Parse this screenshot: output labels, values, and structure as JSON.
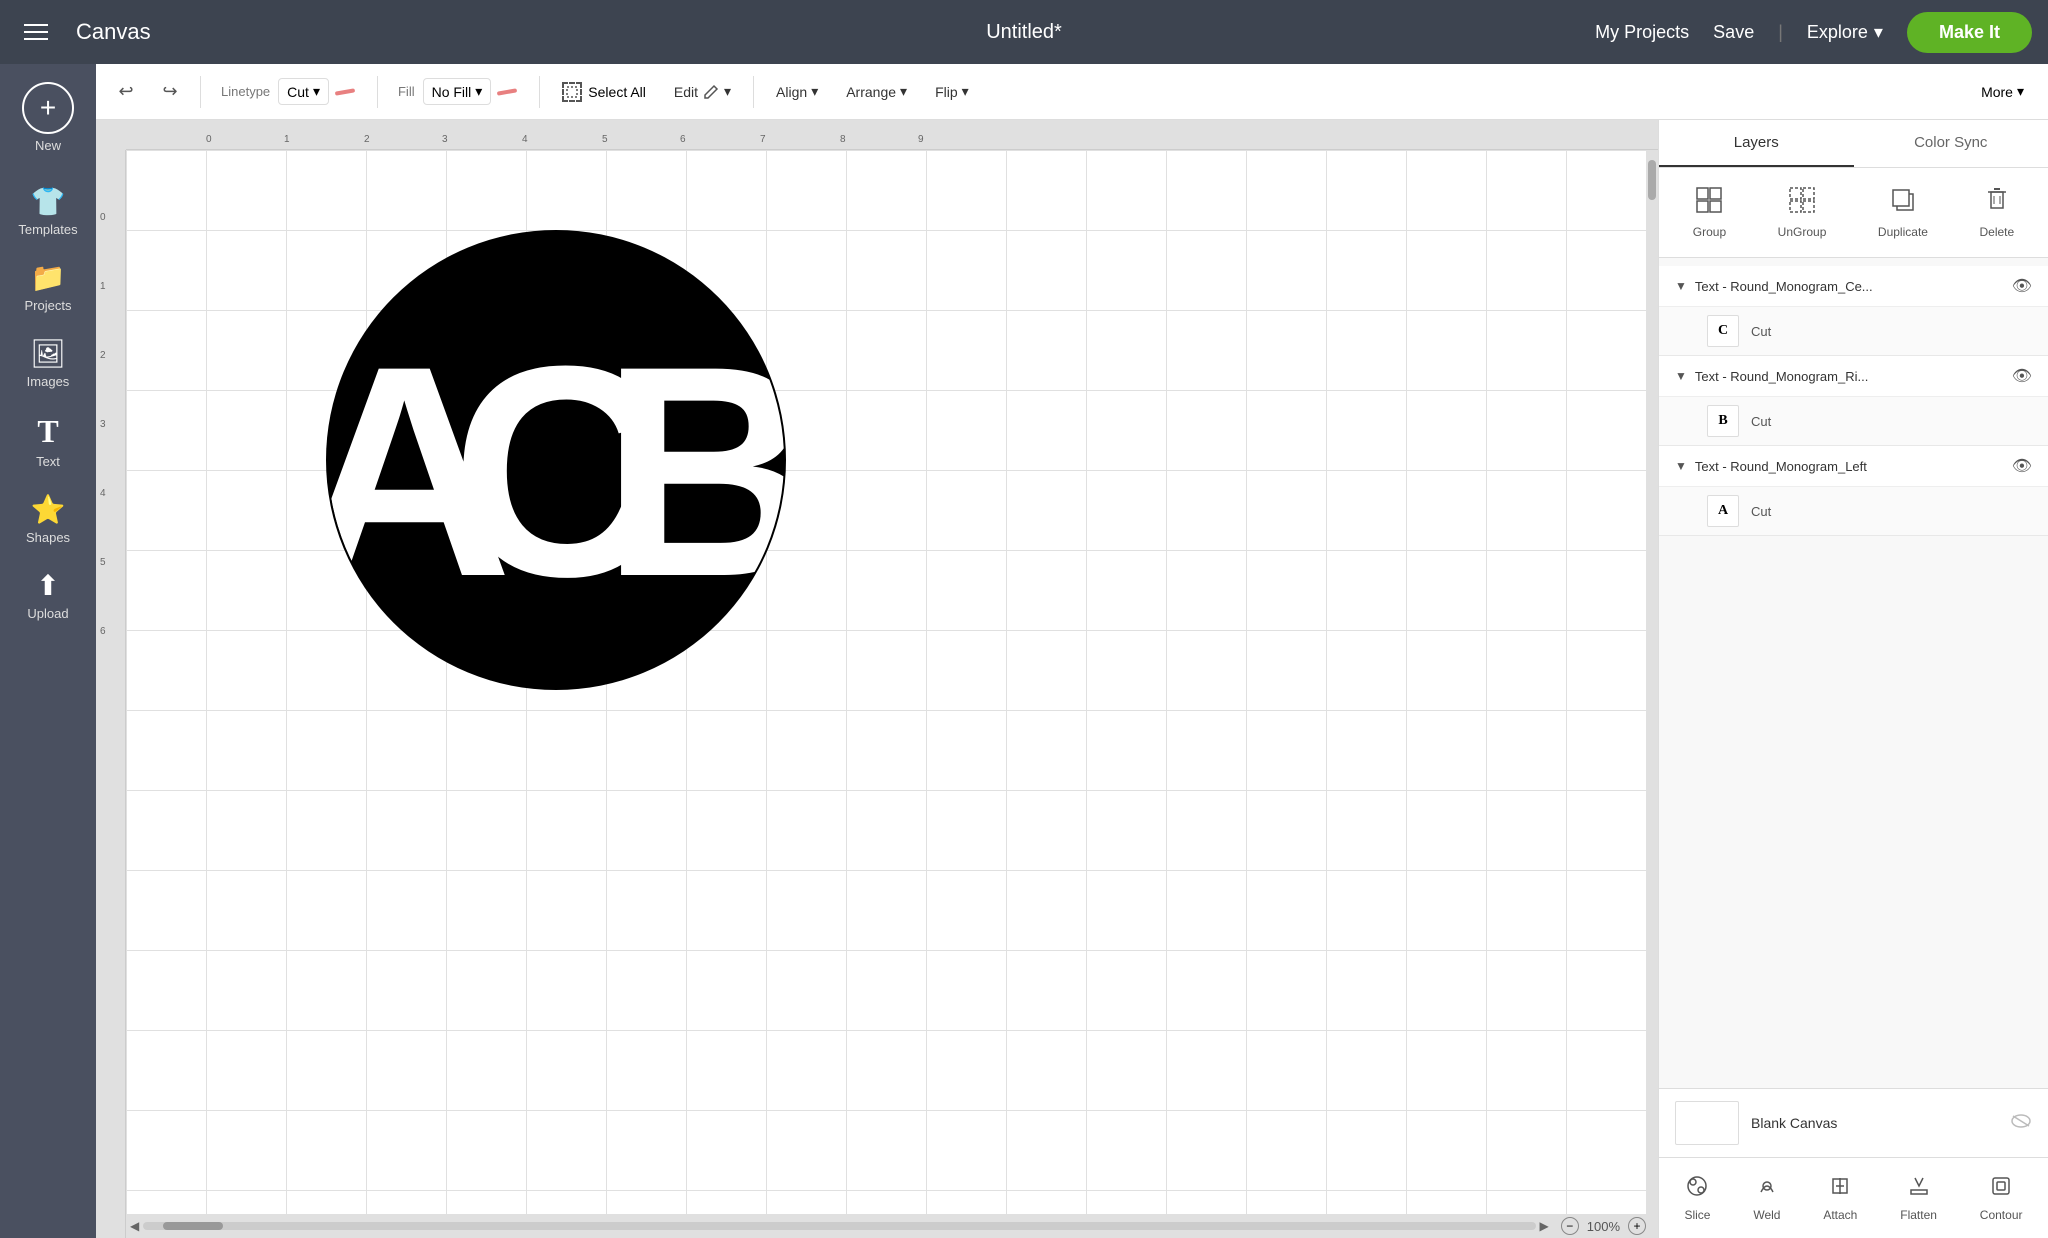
{
  "app": {
    "title": "Canvas",
    "document_title": "Untitled*"
  },
  "topnav": {
    "my_projects": "My Projects",
    "save": "Save",
    "explore": "Explore",
    "make_it": "Make It"
  },
  "sidebar": {
    "new_label": "New",
    "items": [
      {
        "id": "templates",
        "label": "Templates",
        "icon": "👕"
      },
      {
        "id": "projects",
        "label": "Projects",
        "icon": "📁"
      },
      {
        "id": "images",
        "label": "Images",
        "icon": "🖼"
      },
      {
        "id": "text",
        "label": "Text",
        "icon": "T"
      },
      {
        "id": "shapes",
        "label": "Shapes",
        "icon": "⭐"
      },
      {
        "id": "upload",
        "label": "Upload",
        "icon": "⬆"
      }
    ]
  },
  "toolbar": {
    "linetype_label": "Linetype",
    "linetype_value": "Cut",
    "fill_label": "Fill",
    "fill_value": "No Fill",
    "select_all_label": "Select All",
    "edit_label": "Edit",
    "align_label": "Align",
    "arrange_label": "Arrange",
    "flip_label": "Flip",
    "more_label": "More"
  },
  "panel": {
    "tabs": [
      {
        "id": "layers",
        "label": "Layers",
        "active": true
      },
      {
        "id": "color_sync",
        "label": "Color Sync",
        "active": false
      }
    ],
    "actions": [
      {
        "id": "group",
        "label": "Group",
        "disabled": false
      },
      {
        "id": "ungroup",
        "label": "UnGroup",
        "disabled": false
      },
      {
        "id": "duplicate",
        "label": "Duplicate",
        "disabled": false
      },
      {
        "id": "delete",
        "label": "Delete",
        "disabled": false
      }
    ],
    "layers": [
      {
        "id": "layer1",
        "title": "Text - Round_Monogram_Ce...",
        "has_eye": true,
        "children": [
          {
            "thumb_char": "C",
            "cut_label": "Cut"
          }
        ]
      },
      {
        "id": "layer2",
        "title": "Text - Round_Monogram_Ri...",
        "has_eye": true,
        "children": [
          {
            "thumb_char": "B",
            "cut_label": "Cut"
          }
        ]
      },
      {
        "id": "layer3",
        "title": "Text - Round_Monogram_Left",
        "has_eye": true,
        "children": [
          {
            "thumb_char": "A",
            "cut_label": "Cut"
          }
        ]
      }
    ],
    "blank_canvas": {
      "label": "Blank Canvas"
    },
    "bottom_actions": [
      {
        "id": "slice",
        "label": "Slice"
      },
      {
        "id": "weld",
        "label": "Weld"
      },
      {
        "id": "attach",
        "label": "Attach"
      },
      {
        "id": "flatten",
        "label": "Flatten"
      },
      {
        "id": "contour",
        "label": "Contour"
      }
    ]
  },
  "canvas": {
    "zoom_value": "100%"
  },
  "colors": {
    "accent_green": "#5fb325",
    "nav_bg": "#3d4450",
    "sidebar_bg": "#4a5060",
    "linetype_color": "#e88080"
  }
}
